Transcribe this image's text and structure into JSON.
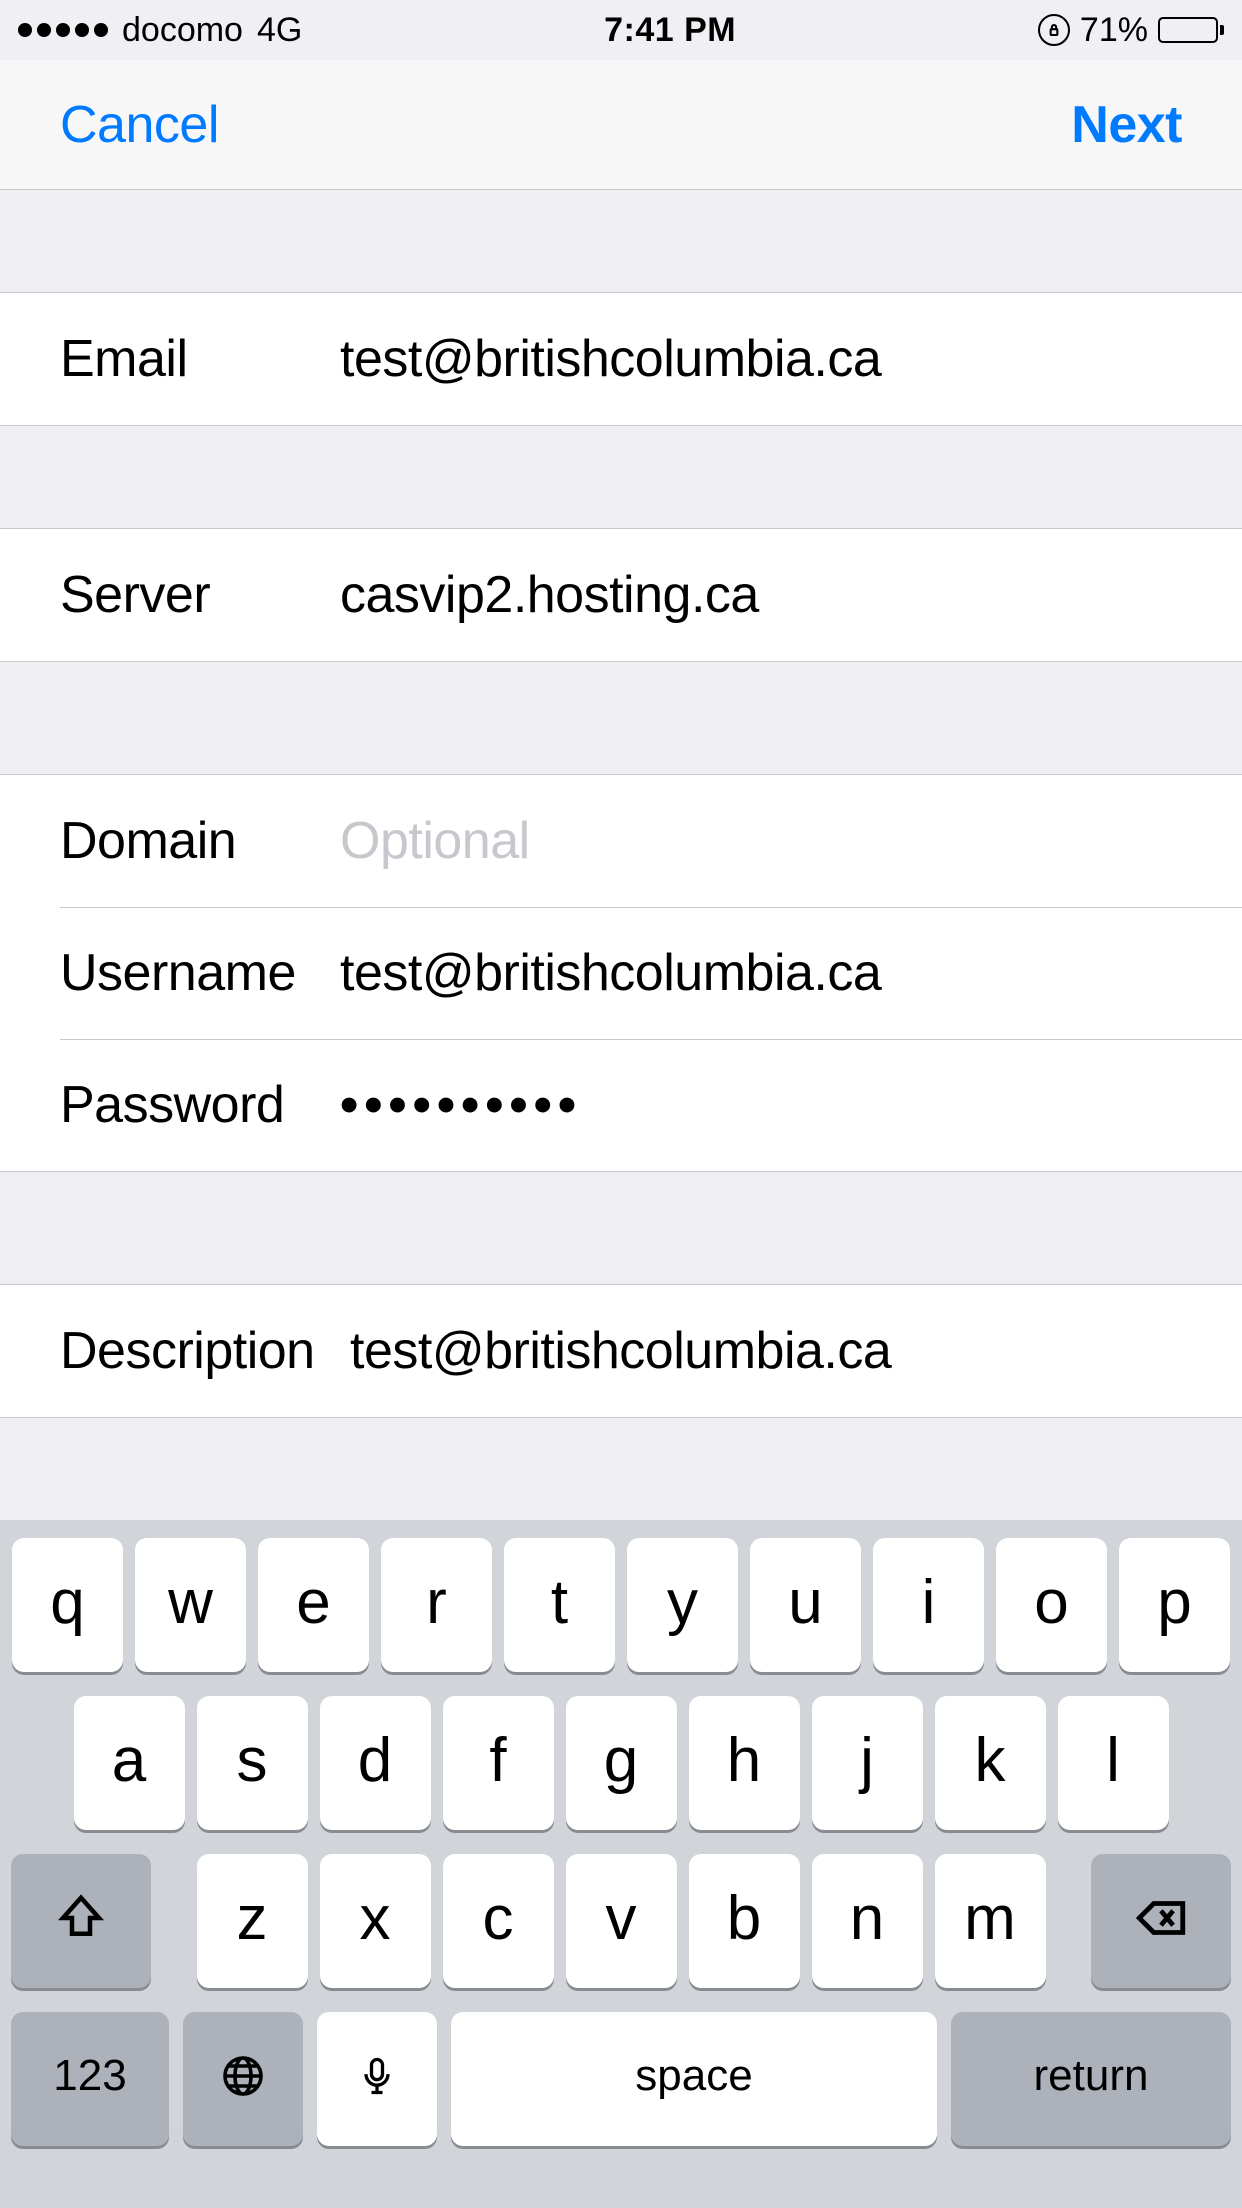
{
  "status": {
    "carrier": "docomo",
    "network": "4G",
    "time": "7:41 PM",
    "battery_pct": "71%"
  },
  "nav": {
    "cancel": "Cancel",
    "next": "Next"
  },
  "form": {
    "email_label": "Email",
    "email_value": "test@britishcolumbia.ca",
    "server_label": "Server",
    "server_value": "casvip2.hosting.ca",
    "domain_label": "Domain",
    "domain_value": "",
    "domain_placeholder": "Optional",
    "username_label": "Username",
    "username_value": "test@britishcolumbia.ca",
    "password_label": "Password",
    "password_value": "••••••••••",
    "description_label": "Description",
    "description_value": "test@britishcolumbia.ca"
  },
  "keyboard": {
    "r1": [
      "q",
      "w",
      "e",
      "r",
      "t",
      "y",
      "u",
      "i",
      "o",
      "p"
    ],
    "r2": [
      "a",
      "s",
      "d",
      "f",
      "g",
      "h",
      "j",
      "k",
      "l"
    ],
    "r3": [
      "z",
      "x",
      "c",
      "v",
      "b",
      "n",
      "m"
    ],
    "numkey": "123",
    "space": "space",
    "return": "return"
  }
}
